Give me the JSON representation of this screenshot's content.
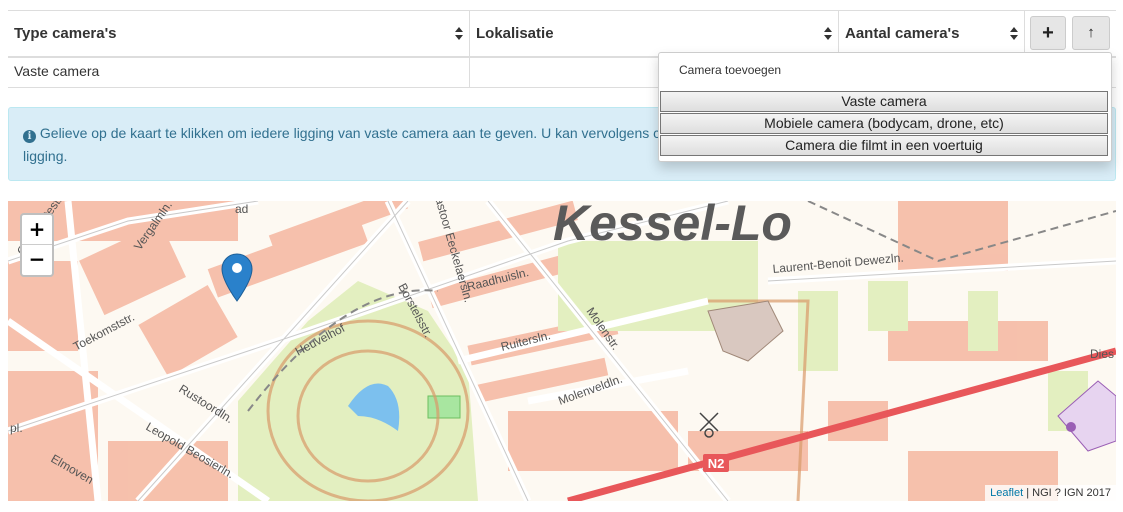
{
  "table": {
    "columns": [
      "Type camera's",
      "Lokalisatie",
      "Aantal camera's"
    ],
    "add_button": "+",
    "up_button": "↑",
    "rows": [
      [
        "Vaste camera",
        "",
        ""
      ]
    ]
  },
  "dropdown": {
    "header": "Camera toevoegen",
    "items": [
      "Vaste camera",
      "Mobiele camera (bodycam, drone, etc)",
      "Camera die filmt in een voertuig"
    ]
  },
  "alert": {
    "icon": "info-circle-icon",
    "text": "Gelieve op de kaart te klikken om iedere ligging van vaste camera aan te geven. U kan vervolgens c",
    "text_line2": "ligging."
  },
  "map": {
    "zoom_in": "+",
    "zoom_out": "−",
    "town_label": "Kessel-Lo",
    "road_badge": "N2",
    "streets": [
      "Heuvelhof",
      "Borstelsstr.",
      "Pastoor Eeckelaersln.",
      "Raadhuisln.",
      "Ruitersln.",
      "Molenstr.",
      "Molenveldln.",
      "Laurent-Benoit Dewezln.",
      "Toekomststr.",
      "Rustoordln.",
      "Leopold Beosierln.",
      "Gemeentestr.",
      "Vergalmln.",
      "Dies",
      "Elmoven",
      "pl.",
      "ad"
    ],
    "attribution_link": "Leaflet",
    "attribution_text": " | NGI ? IGN 2017",
    "colors": {
      "buildings": "#f5b7a0",
      "parks": "#e3efc0",
      "main_road": "#e8575a",
      "marker": "#2a81cb"
    }
  }
}
